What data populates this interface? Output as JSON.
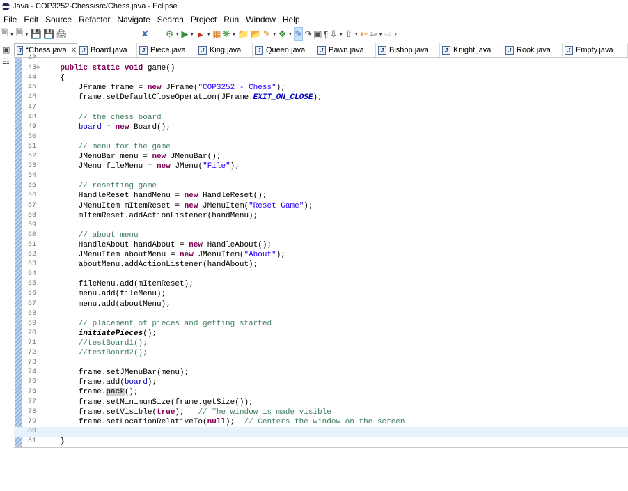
{
  "window": {
    "title": "Java - COP3252-Chess/src/Chess.java - Eclipse"
  },
  "menubar": [
    "File",
    "Edit",
    "Source",
    "Refactor",
    "Navigate",
    "Search",
    "Project",
    "Run",
    "Window",
    "Help"
  ],
  "tabs": [
    {
      "label": "*Chess.java",
      "active": true
    },
    {
      "label": "Board.java"
    },
    {
      "label": "Piece.java"
    },
    {
      "label": "King.java"
    },
    {
      "label": "Queen.java"
    },
    {
      "label": "Pawn.java"
    },
    {
      "label": "Bishop.java"
    },
    {
      "label": "Knight.java"
    },
    {
      "label": "Rook.java"
    },
    {
      "label": "Empty.java"
    }
  ],
  "colors": {
    "keyword": "#7f0055",
    "string": "#2a00ff",
    "comment": "#3f7f5f",
    "field": "#0000c0",
    "current_line": "#e8f2fe"
  },
  "editor": {
    "current_line": "80",
    "lines": [
      {
        "n": "42",
        "fold": false,
        "code": ""
      },
      {
        "n": "43",
        "fold": true,
        "code": "    <span class=\"kw\">public static void</span> game()"
      },
      {
        "n": "44",
        "code": "    {"
      },
      {
        "n": "45",
        "code": "        JFrame frame = <span class=\"kw\">new</span> JFrame(<span class=\"str\">\"COP3252 - Chess\"</span>);"
      },
      {
        "n": "46",
        "code": "        frame.setDefaultCloseOperation(JFrame.<span class=\"sfld\">EXIT_ON_CLOSE</span>);"
      },
      {
        "n": "47",
        "code": ""
      },
      {
        "n": "48",
        "code": "        <span class=\"cm\">// the chess board</span>"
      },
      {
        "n": "49",
        "code": "        <span class=\"fld\">board</span> = <span class=\"kw\">new</span> Board();"
      },
      {
        "n": "50",
        "code": ""
      },
      {
        "n": "51",
        "code": "        <span class=\"cm\">// menu for the game</span>"
      },
      {
        "n": "52",
        "code": "        JMenuBar menu = <span class=\"kw\">new</span> JMenuBar();"
      },
      {
        "n": "53",
        "code": "        JMenu fileMenu = <span class=\"kw\">new</span> JMenu(<span class=\"str\">\"File\"</span>);"
      },
      {
        "n": "54",
        "code": ""
      },
      {
        "n": "55",
        "code": "        <span class=\"cm\">// resetting game</span>"
      },
      {
        "n": "56",
        "code": "        HandleReset handMenu = <span class=\"kw\">new</span> HandleReset();"
      },
      {
        "n": "57",
        "code": "        JMenuItem mItemReset = <span class=\"kw\">new</span> JMenuItem(<span class=\"str\">\"Reset Game\"</span>);"
      },
      {
        "n": "58",
        "code": "        mItemReset.addActionListener(handMenu);"
      },
      {
        "n": "59",
        "code": ""
      },
      {
        "n": "60",
        "code": "        <span class=\"cm\">// about menu</span>"
      },
      {
        "n": "61",
        "code": "        HandleAbout handAbout = <span class=\"kw\">new</span> HandleAbout();"
      },
      {
        "n": "62",
        "code": "        JMenuItem aboutMenu = <span class=\"kw\">new</span> JMenuItem(<span class=\"str\">\"About\"</span>);"
      },
      {
        "n": "63",
        "code": "        aboutMenu.addActionListener(handAbout);"
      },
      {
        "n": "64",
        "code": ""
      },
      {
        "n": "65",
        "code": "        fileMenu.add(mItemReset);"
      },
      {
        "n": "66",
        "code": "        menu.add(fileMenu);"
      },
      {
        "n": "67",
        "code": "        menu.add(aboutMenu);"
      },
      {
        "n": "68",
        "code": ""
      },
      {
        "n": "69",
        "code": "        <span class=\"cm\">// placement of pieces and getting started</span>"
      },
      {
        "n": "70",
        "code": "        <span class=\"mi\">initiatePieces</span>();"
      },
      {
        "n": "71",
        "code": "        <span class=\"cm\">//testBoard1();</span>"
      },
      {
        "n": "72",
        "code": "        <span class=\"cm\">//testBoard2();</span>"
      },
      {
        "n": "73",
        "code": ""
      },
      {
        "n": "74",
        "code": "        frame.setJMenuBar(menu);"
      },
      {
        "n": "75",
        "code": "        frame.add(<span class=\"fld\">board</span>);"
      },
      {
        "n": "76",
        "code": "        frame.<span class=\"occ\">pack</span>();"
      },
      {
        "n": "77",
        "code": "        frame.setMinimumSize(frame.getSize());"
      },
      {
        "n": "78",
        "code": "        frame.setVisible(<span class=\"kw\">true</span>);   <span class=\"cm\">// The window is made visible</span>"
      },
      {
        "n": "79",
        "code": "        frame.setLocationRelativeTo(<span class=\"kw\">null</span>);  <span class=\"cm\">// Centers the window on the screen</span>"
      },
      {
        "n": "80",
        "code": ""
      },
      {
        "n": "81",
        "code": "    }"
      }
    ]
  }
}
